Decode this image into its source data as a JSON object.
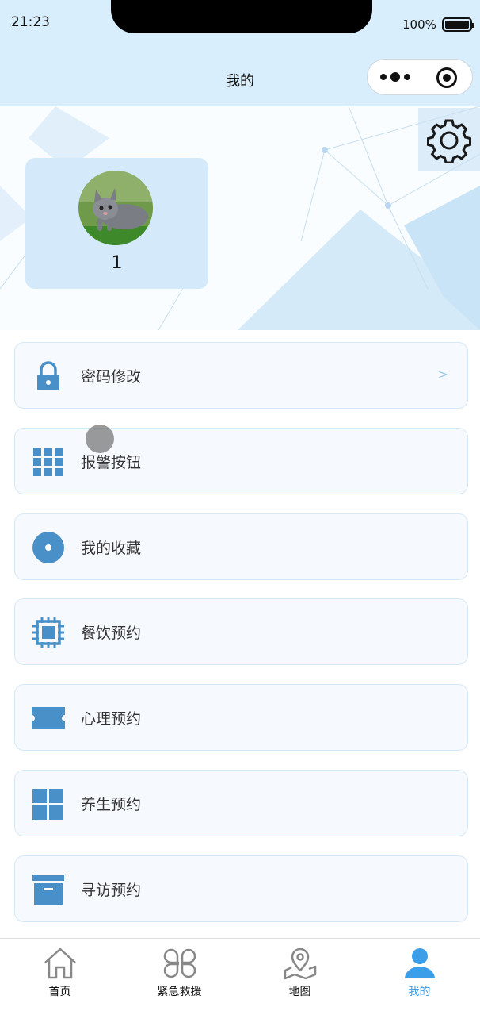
{
  "status_bar": {
    "time": "21:23",
    "battery": "100%"
  },
  "nav": {
    "title": "我的"
  },
  "profile": {
    "name": "1"
  },
  "menu": [
    {
      "label": "密码修改",
      "icon": "lock-icon",
      "arrow": ">"
    },
    {
      "label": "报警按钮",
      "icon": "grid-icon"
    },
    {
      "label": "我的收藏",
      "icon": "disc-icon"
    },
    {
      "label": "餐饮预约",
      "icon": "chip-icon"
    },
    {
      "label": "心理预约",
      "icon": "ticket-icon"
    },
    {
      "label": "养生预约",
      "icon": "apps-icon"
    },
    {
      "label": "寻访预约",
      "icon": "archive-icon"
    }
  ],
  "tabs": [
    {
      "label": "首页",
      "icon": "home-icon"
    },
    {
      "label": "紧急救援",
      "icon": "clover-icon"
    },
    {
      "label": "地图",
      "icon": "map-pin-icon"
    },
    {
      "label": "我的",
      "icon": "user-icon",
      "active": true
    }
  ],
  "colors": {
    "accent": "#3a9ee8",
    "icon": "#4a90c8",
    "topbar": "#d8eefc"
  }
}
